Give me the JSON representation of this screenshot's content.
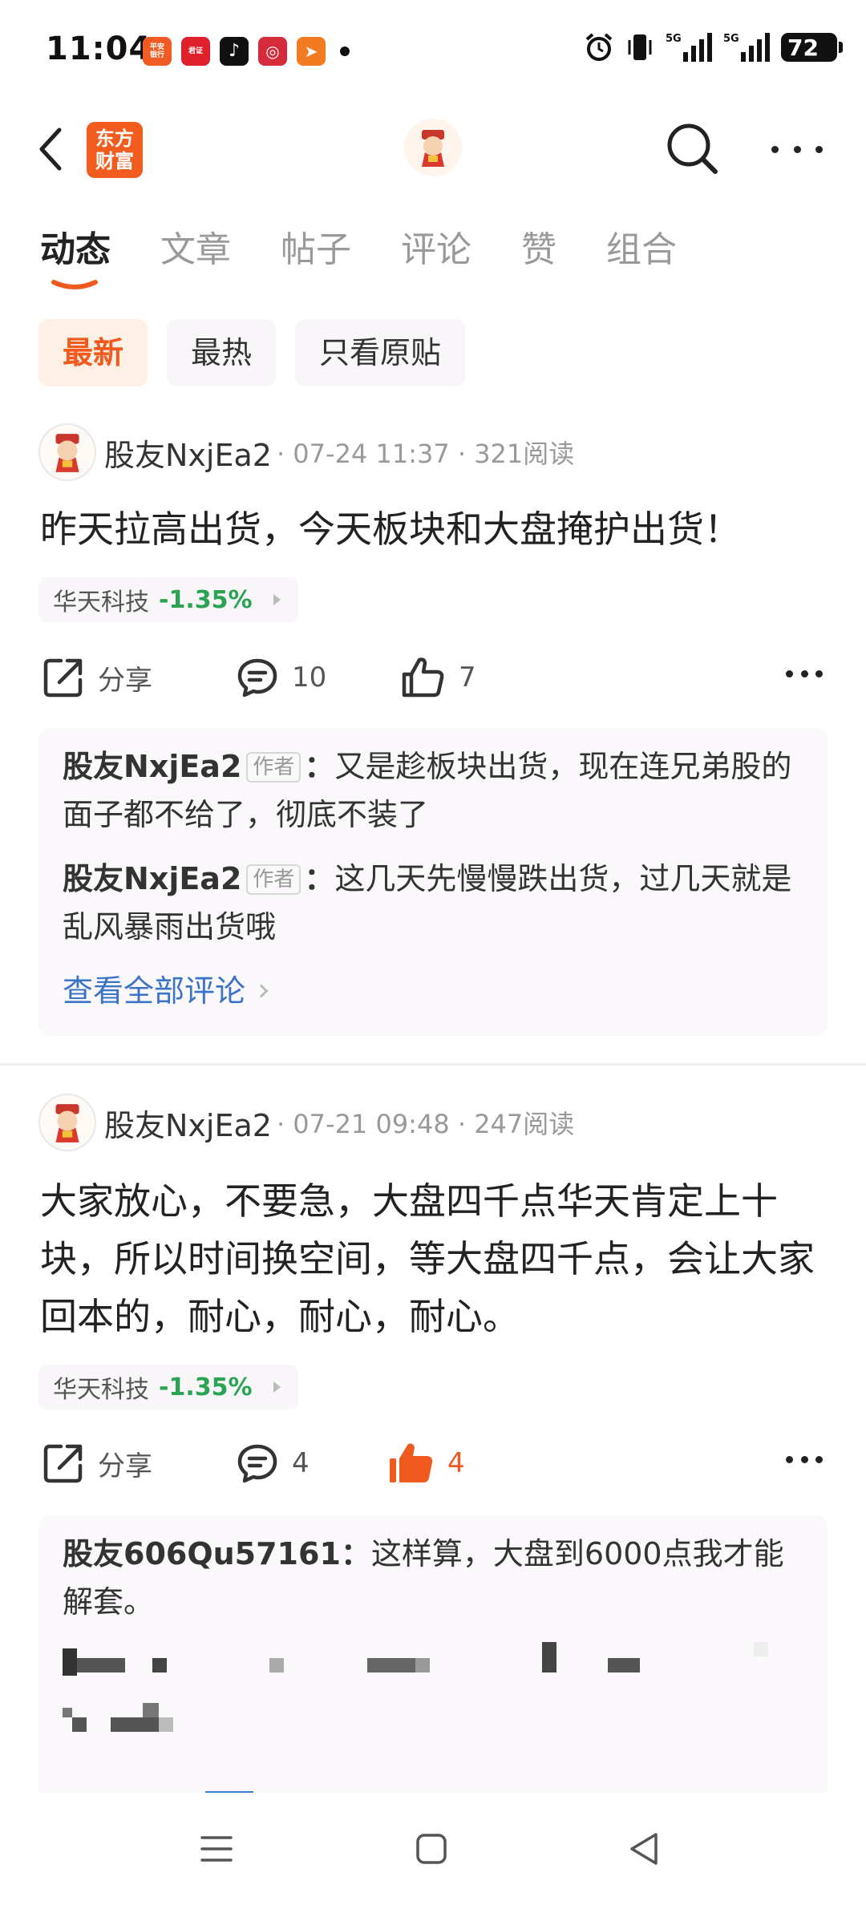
{
  "status_bar": {
    "time": "11:04",
    "notifications": [
      {
        "name": "pingan-bank-icon",
        "label": "平安\n银行"
      },
      {
        "name": "guotai-securities-icon",
        "label": "君证"
      },
      {
        "name": "tiktok-icon",
        "label": "♪"
      },
      {
        "name": "boc-icon",
        "label": "◎"
      },
      {
        "name": "tenpay-icon",
        "label": "➤"
      }
    ],
    "signal_1_label": "5G",
    "signal_2_label": "5G",
    "battery": "72"
  },
  "header": {
    "logo_line1": "东方",
    "logo_line2": "财富"
  },
  "tabs": [
    {
      "label": "动态"
    },
    {
      "label": "文章"
    },
    {
      "label": "帖子"
    },
    {
      "label": "评论"
    },
    {
      "label": "赞"
    },
    {
      "label": "组合"
    }
  ],
  "filters": [
    {
      "label": "最新"
    },
    {
      "label": "最热"
    },
    {
      "label": "只看原贴"
    }
  ],
  "posts": [
    {
      "author": "股友NxjEa2",
      "meta": "· 07-24 11:37 · 321阅读",
      "text": "昨天拉高出货，今天板块和大盘掩护出货！",
      "stock_name": "华天科技",
      "stock_change": "-1.35%",
      "share_label": "分享",
      "comment_count": "10",
      "like_count": "7",
      "comments": [
        {
          "author": "股友NxjEa2",
          "tag": "作者",
          "text": "又是趁板块出货，现在连兄弟股的面子都不给了，彻底不装了"
        },
        {
          "author": "股友NxjEa2",
          "tag": "作者",
          "text": "这几天先慢慢跌出货，过几天就是乱风暴雨出货哦"
        }
      ],
      "view_all": "查看全部评论"
    },
    {
      "author": "股友NxjEa2",
      "meta": "· 07-21 09:48 · 247阅读",
      "text": "大家放心，不要急，大盘四千点华天肯定上十块，所以时间换空间，等大盘四千点，会让大家回本的，耐心，耐心，耐心。",
      "stock_name": "华天科技",
      "stock_change": "-1.35%",
      "share_label": "分享",
      "comment_count": "4",
      "like_count": "4",
      "comments": [
        {
          "author": "股友606Qu57161",
          "text": "这样算，大盘到6000点我才能解套。"
        }
      ]
    }
  ],
  "colors": {
    "accent": "#f05a1e",
    "stock_down": "#2aa352",
    "link": "#3b73c7"
  }
}
